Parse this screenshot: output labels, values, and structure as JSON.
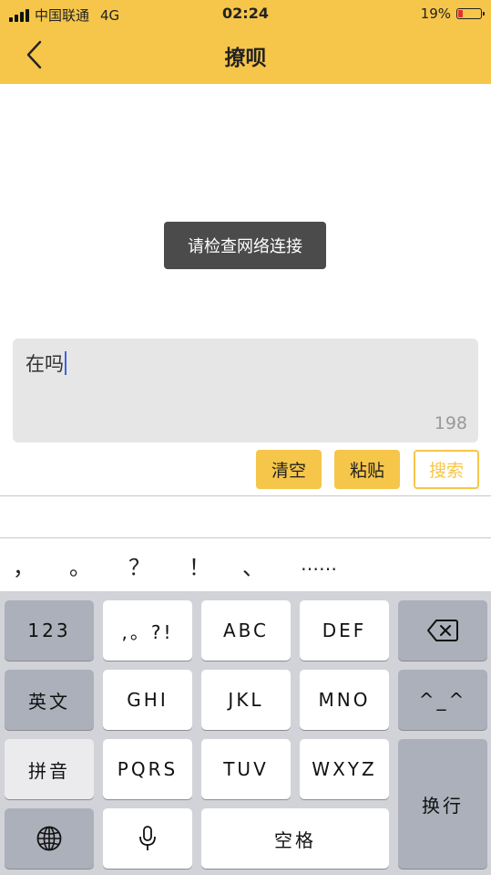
{
  "status_bar": {
    "carrier": "中国联通",
    "network": "4G",
    "time": "02:24",
    "battery": "19%",
    "battery_level": 0.19
  },
  "nav": {
    "back_icon": "chevron-left-icon",
    "title": "撩呗"
  },
  "toast": {
    "message": "请检查网络连接"
  },
  "input": {
    "value": "在吗",
    "remaining": "198"
  },
  "actions": {
    "clear": "清空",
    "paste": "粘贴",
    "search": "搜索"
  },
  "candidates": [
    "，",
    "。",
    "？",
    "！",
    "、",
    "……"
  ],
  "keyboard": {
    "row1": [
      "123",
      ",。?!",
      "ABC",
      "DEF"
    ],
    "delete_icon": "backspace-icon",
    "row2": [
      "英文",
      "GHI",
      "JKL",
      "MNO",
      "^_^"
    ],
    "row3": [
      "拼音",
      "PQRS",
      "TUV",
      "WXYZ"
    ],
    "return_key": "换行",
    "globe_icon": "globe-icon",
    "mic_icon": "microphone-icon",
    "space": "空格"
  },
  "colors": {
    "accent": "#f6c64a",
    "toast_bg": "#4b4b4b",
    "input_bg": "#e6e6e6",
    "caret": "#3b64e6",
    "battery_low": "#e0332a"
  }
}
